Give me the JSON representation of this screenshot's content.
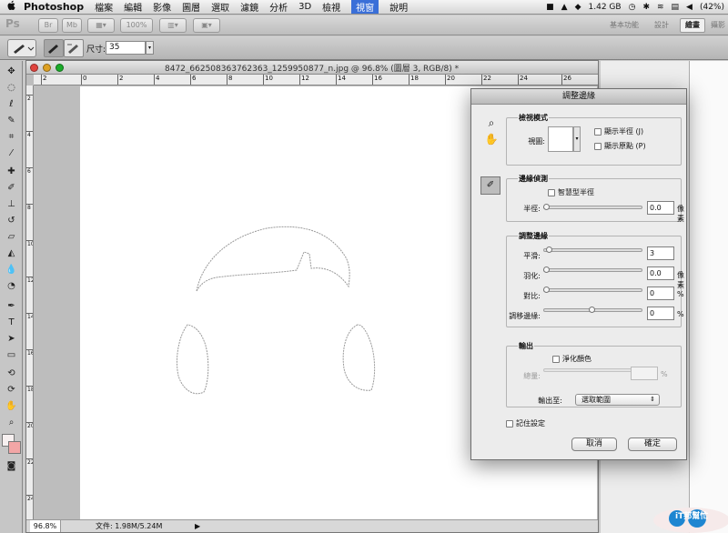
{
  "menubar": {
    "apple": "",
    "app_name": "Photoshop",
    "items": [
      "檔案",
      "編輯",
      "影像",
      "圖層",
      "選取",
      "濾鏡",
      "分析",
      "3D",
      "檢視",
      "視窗",
      "說明"
    ],
    "status": {
      "disk": "1.42 GB",
      "battery": "(42%)"
    }
  },
  "appbar": {
    "logo": "Ps",
    "br": "Br",
    "mb": "Mb",
    "zoom": "100%",
    "workspaces": [
      "基本功能",
      "設計",
      "繪畫",
      "攝影"
    ],
    "active_workspace": "繪畫"
  },
  "optionsbar": {
    "size_label": "尺寸:",
    "size_value": "35"
  },
  "document": {
    "title": "8472_662508363762363_1259950877_n.jpg @ 96.8% (圖層 3, RGB/8) *",
    "ruler_h": [
      "2",
      "0",
      "2",
      "4",
      "6",
      "8",
      "10",
      "12",
      "14",
      "16",
      "18",
      "20",
      "22",
      "24",
      "26"
    ],
    "ruler_v": [
      "2",
      "4",
      "6",
      "8",
      "10",
      "12",
      "14",
      "16",
      "18",
      "20",
      "22",
      "24"
    ],
    "zoom": "96.8%",
    "file_info": "文件: 1.98M/5.24M"
  },
  "dialog": {
    "title": "調整邊緣",
    "view_mode": {
      "title": "檢視模式",
      "view_label": "視圖:",
      "show_radius": "顯示半徑 (J)",
      "show_original": "顯示原點 (P)"
    },
    "edge_detection": {
      "title": "邊緣偵測",
      "smart_radius": "智慧型半徑",
      "radius_label": "半徑:",
      "radius_value": "0.0",
      "radius_unit": "像素",
      "radius_level": 0
    },
    "adjust_edge": {
      "title": "調整邊緣",
      "smooth_label": "平滑:",
      "smooth_value": "3",
      "smooth_level": 0.03,
      "feather_label": "羽化:",
      "feather_value": "0.0",
      "feather_unit": "像素",
      "feather_level": 0,
      "contrast_label": "對比:",
      "contrast_value": "0",
      "contrast_unit": "%",
      "contrast_level": 0,
      "shift_label": "調移邊緣:",
      "shift_value": "0",
      "shift_unit": "%",
      "shift_level": 0.5
    },
    "output": {
      "title": "輸出",
      "decontaminate": "淨化顏色",
      "amount_label": "總量:",
      "amount_unit": "%",
      "output_to_label": "輸出至:",
      "output_to_value": "選取範圍"
    },
    "remember": "記住設定",
    "cancel": "取消",
    "ok": "確定"
  },
  "watermark": {
    "text": "iT邦幫忙"
  },
  "colors": {
    "foreground": "#f7f0f0",
    "background": "#f2a6a6",
    "accent": "#3a6fd8"
  }
}
